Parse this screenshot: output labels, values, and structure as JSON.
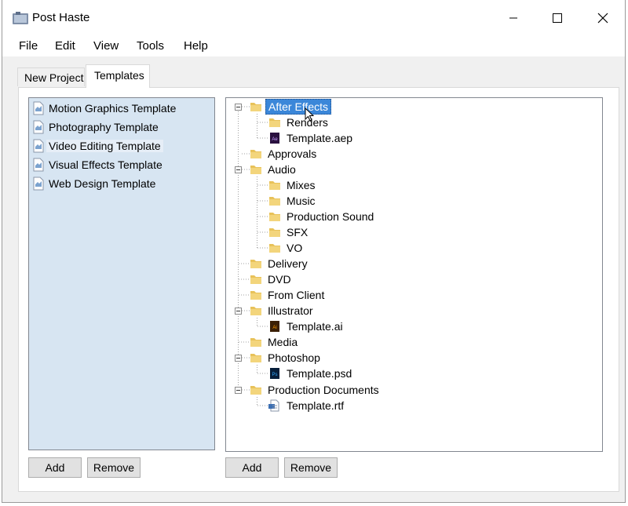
{
  "window": {
    "title": "Post Haste"
  },
  "menu": {
    "items": [
      "File",
      "Edit",
      "View",
      "Tools",
      "Help"
    ]
  },
  "tabs": {
    "new_project": "New Project",
    "templates": "Templates"
  },
  "templates_list": {
    "items": [
      "Motion Graphics Template",
      "Photography Template",
      "Video Editing Template",
      "Visual Effects Template",
      "Web Design Template"
    ],
    "selected_index": 2
  },
  "tree": {
    "nodes": [
      {
        "label": "After Effects",
        "icon": "folder-icon"
      },
      {
        "label": "Renders",
        "icon": "folder-icon"
      },
      {
        "label": "Template.aep",
        "icon": "after-effects-file-icon"
      },
      {
        "label": "Approvals",
        "icon": "folder-icon"
      },
      {
        "label": "Audio",
        "icon": "folder-icon"
      },
      {
        "label": "Mixes",
        "icon": "folder-icon"
      },
      {
        "label": "Music",
        "icon": "folder-icon"
      },
      {
        "label": "Production Sound",
        "icon": "folder-icon"
      },
      {
        "label": "SFX",
        "icon": "folder-icon"
      },
      {
        "label": "VO",
        "icon": "folder-icon"
      },
      {
        "label": "Delivery",
        "icon": "folder-icon"
      },
      {
        "label": "DVD",
        "icon": "folder-icon"
      },
      {
        "label": "From Client",
        "icon": "folder-icon"
      },
      {
        "label": "Illustrator",
        "icon": "folder-icon"
      },
      {
        "label": "Template.ai",
        "icon": "illustrator-file-icon"
      },
      {
        "label": "Media",
        "icon": "folder-icon"
      },
      {
        "label": "Photoshop",
        "icon": "folder-icon"
      },
      {
        "label": "Template.psd",
        "icon": "photoshop-file-icon"
      },
      {
        "label": "Production Documents",
        "icon": "folder-icon"
      },
      {
        "label": "Template.rtf",
        "icon": "rtf-document-icon"
      }
    ],
    "selected_label": "After Effects",
    "file_badges": {
      "aep": "Ae",
      "ai": "Ai",
      "psd": "Ps"
    }
  },
  "buttons": {
    "add": "Add",
    "remove": "Remove"
  },
  "colors": {
    "list_bg": "#d7e5f2",
    "tree_selection": "#3b87d9",
    "folder": "#e8c25a"
  }
}
